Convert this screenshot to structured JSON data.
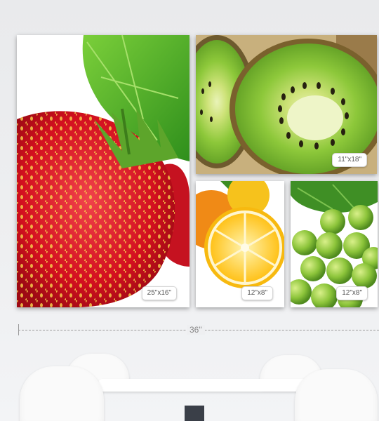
{
  "prints": {
    "strawberry": {
      "size_label": "25\"x16\""
    },
    "kiwi": {
      "size_label": "11\"x18\""
    },
    "orange": {
      "size_label": "12\"x8\""
    },
    "grapes": {
      "size_label": "12\"x8\""
    }
  },
  "dimension": {
    "label": "36\""
  }
}
